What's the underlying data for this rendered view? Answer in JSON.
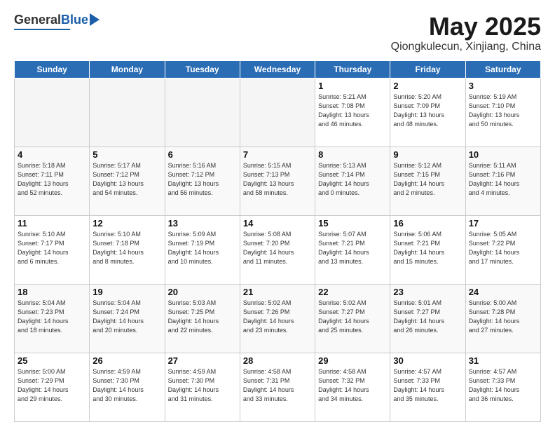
{
  "logo": {
    "general": "General",
    "blue": "Blue"
  },
  "header": {
    "title": "May 2025",
    "subtitle": "Qiongkulecun, Xinjiang, China"
  },
  "days_of_week": [
    "Sunday",
    "Monday",
    "Tuesday",
    "Wednesday",
    "Thursday",
    "Friday",
    "Saturday"
  ],
  "weeks": [
    [
      {
        "day": "",
        "info": ""
      },
      {
        "day": "",
        "info": ""
      },
      {
        "day": "",
        "info": ""
      },
      {
        "day": "",
        "info": ""
      },
      {
        "day": "1",
        "info": "Sunrise: 5:21 AM\nSunset: 7:08 PM\nDaylight: 13 hours\nand 46 minutes."
      },
      {
        "day": "2",
        "info": "Sunrise: 5:20 AM\nSunset: 7:09 PM\nDaylight: 13 hours\nand 48 minutes."
      },
      {
        "day": "3",
        "info": "Sunrise: 5:19 AM\nSunset: 7:10 PM\nDaylight: 13 hours\nand 50 minutes."
      }
    ],
    [
      {
        "day": "4",
        "info": "Sunrise: 5:18 AM\nSunset: 7:11 PM\nDaylight: 13 hours\nand 52 minutes."
      },
      {
        "day": "5",
        "info": "Sunrise: 5:17 AM\nSunset: 7:12 PM\nDaylight: 13 hours\nand 54 minutes."
      },
      {
        "day": "6",
        "info": "Sunrise: 5:16 AM\nSunset: 7:12 PM\nDaylight: 13 hours\nand 56 minutes."
      },
      {
        "day": "7",
        "info": "Sunrise: 5:15 AM\nSunset: 7:13 PM\nDaylight: 13 hours\nand 58 minutes."
      },
      {
        "day": "8",
        "info": "Sunrise: 5:13 AM\nSunset: 7:14 PM\nDaylight: 14 hours\nand 0 minutes."
      },
      {
        "day": "9",
        "info": "Sunrise: 5:12 AM\nSunset: 7:15 PM\nDaylight: 14 hours\nand 2 minutes."
      },
      {
        "day": "10",
        "info": "Sunrise: 5:11 AM\nSunset: 7:16 PM\nDaylight: 14 hours\nand 4 minutes."
      }
    ],
    [
      {
        "day": "11",
        "info": "Sunrise: 5:10 AM\nSunset: 7:17 PM\nDaylight: 14 hours\nand 6 minutes."
      },
      {
        "day": "12",
        "info": "Sunrise: 5:10 AM\nSunset: 7:18 PM\nDaylight: 14 hours\nand 8 minutes."
      },
      {
        "day": "13",
        "info": "Sunrise: 5:09 AM\nSunset: 7:19 PM\nDaylight: 14 hours\nand 10 minutes."
      },
      {
        "day": "14",
        "info": "Sunrise: 5:08 AM\nSunset: 7:20 PM\nDaylight: 14 hours\nand 11 minutes."
      },
      {
        "day": "15",
        "info": "Sunrise: 5:07 AM\nSunset: 7:21 PM\nDaylight: 14 hours\nand 13 minutes."
      },
      {
        "day": "16",
        "info": "Sunrise: 5:06 AM\nSunset: 7:21 PM\nDaylight: 14 hours\nand 15 minutes."
      },
      {
        "day": "17",
        "info": "Sunrise: 5:05 AM\nSunset: 7:22 PM\nDaylight: 14 hours\nand 17 minutes."
      }
    ],
    [
      {
        "day": "18",
        "info": "Sunrise: 5:04 AM\nSunset: 7:23 PM\nDaylight: 14 hours\nand 18 minutes."
      },
      {
        "day": "19",
        "info": "Sunrise: 5:04 AM\nSunset: 7:24 PM\nDaylight: 14 hours\nand 20 minutes."
      },
      {
        "day": "20",
        "info": "Sunrise: 5:03 AM\nSunset: 7:25 PM\nDaylight: 14 hours\nand 22 minutes."
      },
      {
        "day": "21",
        "info": "Sunrise: 5:02 AM\nSunset: 7:26 PM\nDaylight: 14 hours\nand 23 minutes."
      },
      {
        "day": "22",
        "info": "Sunrise: 5:02 AM\nSunset: 7:27 PM\nDaylight: 14 hours\nand 25 minutes."
      },
      {
        "day": "23",
        "info": "Sunrise: 5:01 AM\nSunset: 7:27 PM\nDaylight: 14 hours\nand 26 minutes."
      },
      {
        "day": "24",
        "info": "Sunrise: 5:00 AM\nSunset: 7:28 PM\nDaylight: 14 hours\nand 27 minutes."
      }
    ],
    [
      {
        "day": "25",
        "info": "Sunrise: 5:00 AM\nSunset: 7:29 PM\nDaylight: 14 hours\nand 29 minutes."
      },
      {
        "day": "26",
        "info": "Sunrise: 4:59 AM\nSunset: 7:30 PM\nDaylight: 14 hours\nand 30 minutes."
      },
      {
        "day": "27",
        "info": "Sunrise: 4:59 AM\nSunset: 7:30 PM\nDaylight: 14 hours\nand 31 minutes."
      },
      {
        "day": "28",
        "info": "Sunrise: 4:58 AM\nSunset: 7:31 PM\nDaylight: 14 hours\nand 33 minutes."
      },
      {
        "day": "29",
        "info": "Sunrise: 4:58 AM\nSunset: 7:32 PM\nDaylight: 14 hours\nand 34 minutes."
      },
      {
        "day": "30",
        "info": "Sunrise: 4:57 AM\nSunset: 7:33 PM\nDaylight: 14 hours\nand 35 minutes."
      },
      {
        "day": "31",
        "info": "Sunrise: 4:57 AM\nSunset: 7:33 PM\nDaylight: 14 hours\nand 36 minutes."
      }
    ]
  ]
}
